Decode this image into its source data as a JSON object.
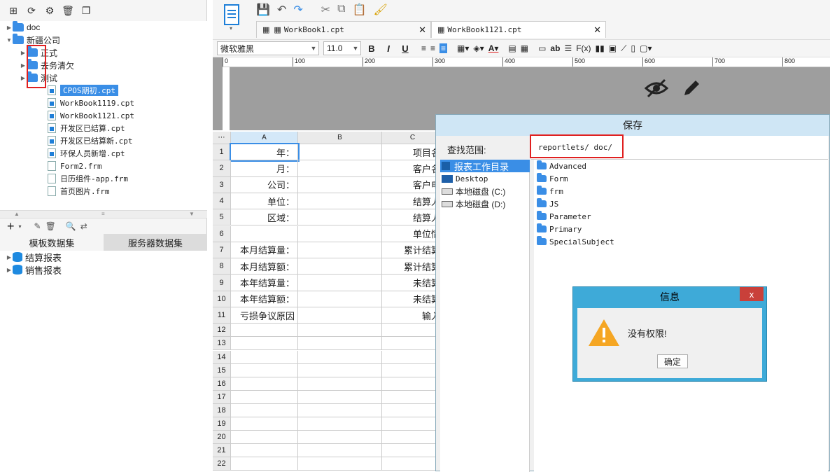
{
  "left_tree": {
    "items": [
      {
        "label": "doc",
        "type": "folder",
        "expanded": false
      },
      {
        "label": "新疆公司",
        "type": "folder",
        "expanded": true
      },
      {
        "label": "正式",
        "type": "folder"
      },
      {
        "label": "去务清欠",
        "type": "folder"
      },
      {
        "label": "测试",
        "type": "folder"
      },
      {
        "label": "CPOS期初.cpt",
        "type": "cpt",
        "selected": true
      },
      {
        "label": "WorkBook1119.cpt",
        "type": "cpt"
      },
      {
        "label": "WorkBook1121.cpt",
        "type": "cpt"
      },
      {
        "label": "开发区已结算.cpt",
        "type": "cpt"
      },
      {
        "label": "开发区已结算新.cpt",
        "type": "cpt"
      },
      {
        "label": "环保人员新增.cpt",
        "type": "cpt"
      },
      {
        "label": "Form2.frm",
        "type": "frm"
      },
      {
        "label": "日历组件-app.frm",
        "type": "frm"
      },
      {
        "label": "首页图片.frm",
        "type": "frm"
      }
    ]
  },
  "dataset": {
    "tabs": [
      "模板数据集",
      "服务器数据集"
    ],
    "items": [
      "结算报表",
      "销售报表"
    ]
  },
  "editor": {
    "tabs": [
      {
        "label": "WorkBook1.cpt"
      },
      {
        "label": "WorkBook1121.cpt"
      }
    ],
    "font_name": "微软雅黑",
    "font_size": "11.0",
    "ruler_ticks": [
      "0",
      "100",
      "200",
      "300",
      "400",
      "500",
      "600",
      "700",
      "800"
    ],
    "columns": [
      "A",
      "B",
      "C"
    ],
    "rows": [
      {
        "n": "1",
        "a": "年：",
        "c": "项目名"
      },
      {
        "n": "2",
        "a": "月：",
        "c": "客户名"
      },
      {
        "n": "3",
        "a": "公司：",
        "c": "客户电"
      },
      {
        "n": "4",
        "a": "单位：",
        "c": "结算人"
      },
      {
        "n": "5",
        "a": "区域：",
        "c": "结算人"
      },
      {
        "n": "6",
        "a": "",
        "c": "单位情"
      },
      {
        "n": "7",
        "a": "本月结算量：",
        "c": "累计结算"
      },
      {
        "n": "8",
        "a": "本月结算额：",
        "c": "累计结算"
      },
      {
        "n": "9",
        "a": "本年结算量：",
        "c": "未结算"
      },
      {
        "n": "10",
        "a": "本年结算额：",
        "c": "未结算"
      },
      {
        "n": "11",
        "a": "亏损争议原因",
        "c": "输入"
      },
      {
        "n": "12",
        "a": "",
        "c": ""
      },
      {
        "n": "13",
        "a": "",
        "c": ""
      },
      {
        "n": "14",
        "a": "",
        "c": ""
      },
      {
        "n": "15",
        "a": "",
        "c": ""
      },
      {
        "n": "16",
        "a": "",
        "c": ""
      },
      {
        "n": "17",
        "a": "",
        "c": ""
      },
      {
        "n": "18",
        "a": "",
        "c": ""
      },
      {
        "n": "19",
        "a": "",
        "c": ""
      },
      {
        "n": "20",
        "a": "",
        "c": ""
      },
      {
        "n": "21",
        "a": "",
        "c": ""
      },
      {
        "n": "22",
        "a": "",
        "c": ""
      }
    ]
  },
  "save_dialog": {
    "title": "保存",
    "lookin_label": "查找范围:",
    "path": "reportlets/ doc/",
    "locations": [
      "报表工作目录",
      "Desktop",
      "本地磁盘 (C:)",
      "本地磁盘 (D:)"
    ],
    "folders": [
      "Advanced",
      "Form",
      "frm",
      "JS",
      "Parameter",
      "Primary",
      "SpecialSubject"
    ]
  },
  "info_dialog": {
    "title": "信息",
    "close": "x",
    "message": "没有权限!",
    "ok": "确定"
  }
}
